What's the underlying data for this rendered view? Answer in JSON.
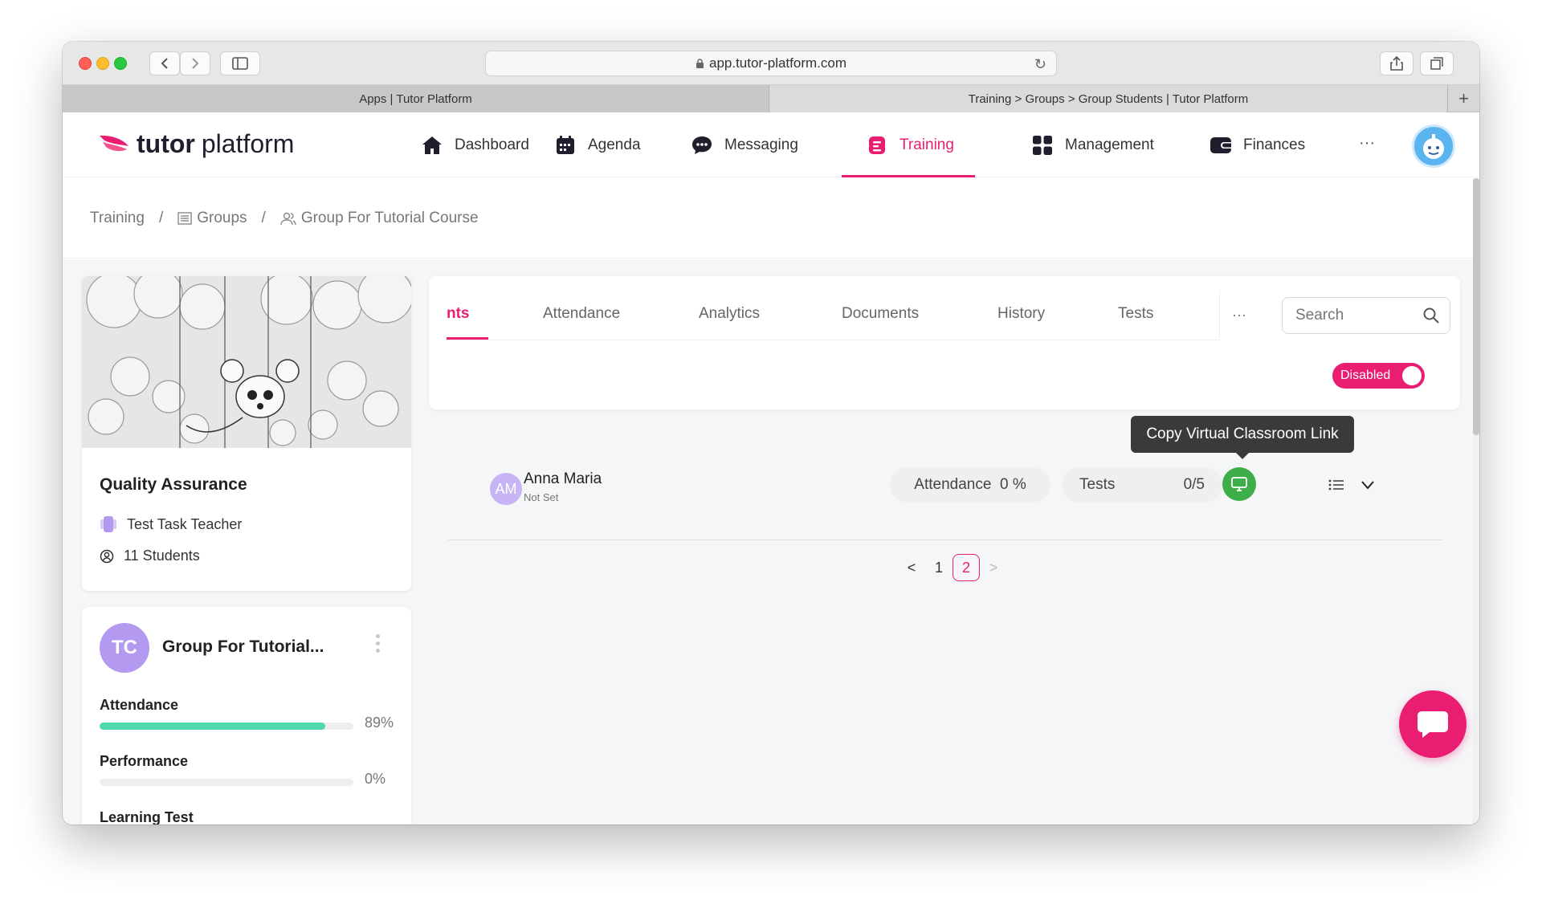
{
  "browser": {
    "url": "app.tutor-platform.com",
    "tabs": [
      {
        "title": "Apps | Tutor Platform"
      },
      {
        "title": "Training > Groups > Group Students | Tutor Platform"
      }
    ]
  },
  "app": {
    "logo_bold": "tutor",
    "logo_light": "platform",
    "nav": [
      {
        "label": "Dashboard",
        "icon": "home-icon"
      },
      {
        "label": "Agenda",
        "icon": "calendar-icon"
      },
      {
        "label": "Messaging",
        "icon": "chat-bubble-icon"
      },
      {
        "label": "Training",
        "icon": "training-icon",
        "active": true
      },
      {
        "label": "Management",
        "icon": "grid-icon"
      },
      {
        "label": "Finances",
        "icon": "wallet-icon"
      }
    ],
    "nav_more": "···",
    "accent_color": "#e91e72"
  },
  "breadcrumb": {
    "items": [
      "Training",
      "Groups",
      "Group For Tutorial Course"
    ],
    "separator": "/"
  },
  "course_card": {
    "title": "Quality Assurance",
    "teacher": "Test Task Teacher",
    "students": "11 Students"
  },
  "group_card": {
    "initials": "TC",
    "title": "Group For Tutorial...",
    "stats": [
      {
        "label": "Attendance",
        "percent": 89,
        "display": "89%"
      },
      {
        "label": "Performance",
        "percent": 0,
        "display": "0%"
      },
      {
        "label": "Learning Test"
      }
    ]
  },
  "tabs": {
    "items": [
      "nts",
      "Attendance",
      "Analytics",
      "Documents",
      "History",
      "Tests"
    ],
    "active_index": 0,
    "more": "···"
  },
  "search": {
    "placeholder": "Search"
  },
  "toggle": {
    "label": "Disabled"
  },
  "tooltip": "Copy Virtual Classroom Link",
  "student": {
    "initials": "AM",
    "name": "Anna Maria",
    "subtitle": "Not Set",
    "attendance_label": "Attendance",
    "attendance_value": "0 %",
    "tests_label": "Tests",
    "tests_value": "0/5"
  },
  "pagination": {
    "pages": [
      "1",
      "2"
    ],
    "current": "2",
    "prev": "<",
    "next": ">"
  }
}
